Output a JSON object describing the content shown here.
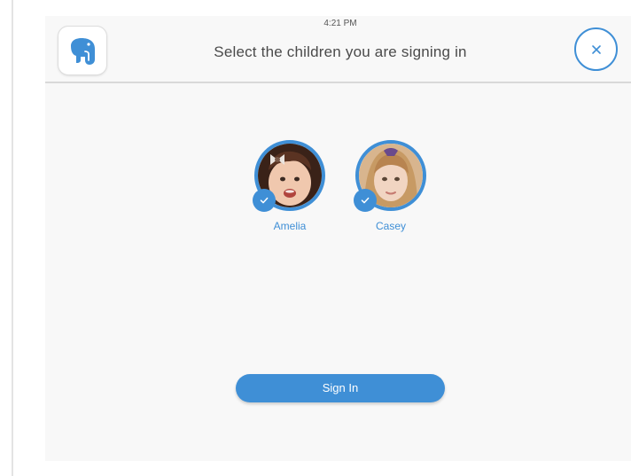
{
  "status_bar": {
    "time": "4:21 PM"
  },
  "header": {
    "logo_icon": "elephant-icon",
    "title": "Select the children you are signing in",
    "close_icon": "close-icon"
  },
  "children": [
    {
      "name": "Amelia",
      "selected": true,
      "avatar_icon": "child-photo"
    },
    {
      "name": "Casey",
      "selected": true,
      "avatar_icon": "child-photo"
    }
  ],
  "actions": {
    "sign_in_label": "Sign In"
  },
  "colors": {
    "accent": "#3f8fd6",
    "background": "#f8f8f8",
    "title_text": "#4a4a4a"
  }
}
